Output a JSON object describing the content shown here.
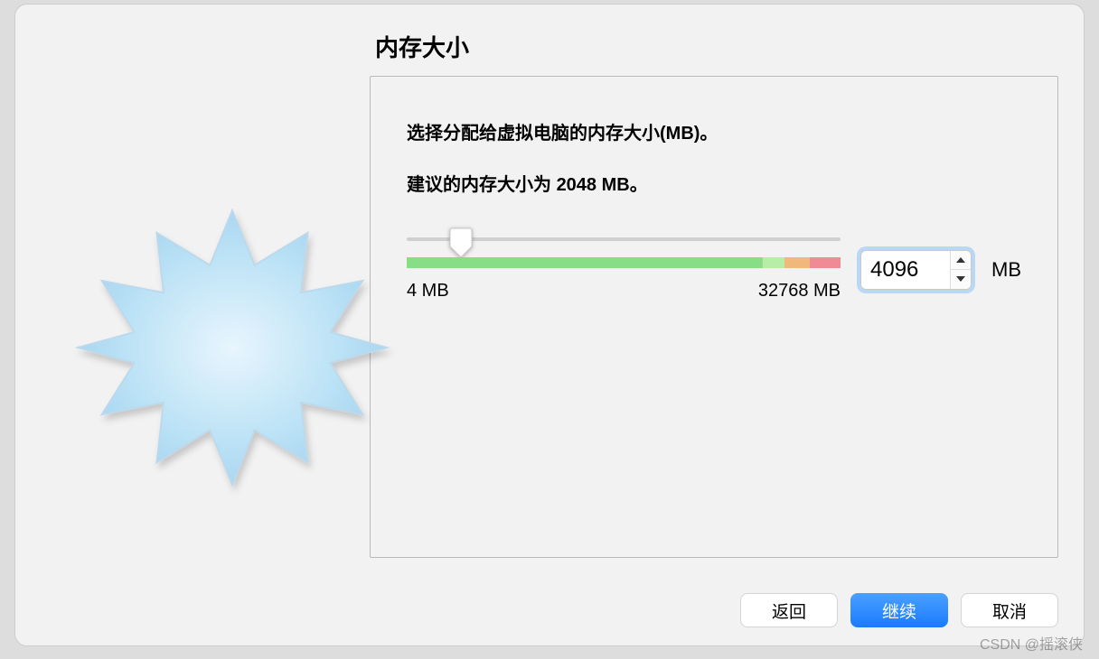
{
  "title": "内存大小",
  "description": "选择分配给虚拟电脑的内存大小(MB)。",
  "suggestion_prefix": "建议的内存大小为 ",
  "suggestion_bold": "2048",
  "suggestion_suffix": " MB。",
  "slider": {
    "min_label": "4 MB",
    "max_label": "32768 MB",
    "thumb_percent": 12.5
  },
  "stepper": {
    "value": "4096",
    "unit": "MB"
  },
  "buttons": {
    "back": "返回",
    "continue": "继续",
    "cancel": "取消"
  },
  "watermark": "CSDN @摇滚侠"
}
